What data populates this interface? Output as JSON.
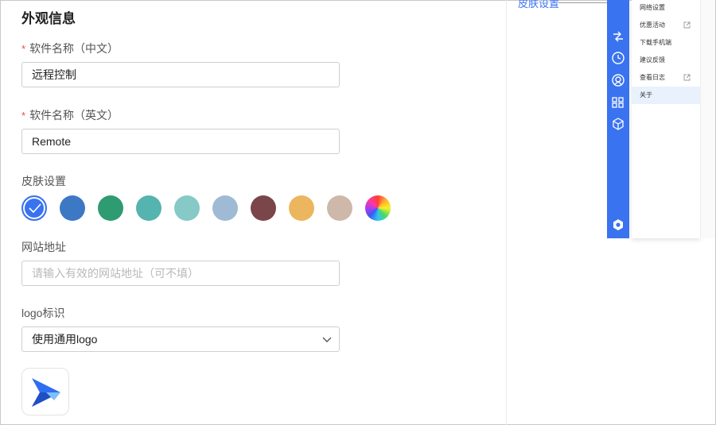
{
  "form": {
    "section_title": "外观信息",
    "required_mark": "*",
    "name_cn": {
      "label": "软件名称（中文）",
      "value": "远程控制"
    },
    "name_en": {
      "label": "软件名称（英文）",
      "value": "Remote"
    },
    "skin": {
      "label": "皮肤设置",
      "swatches": [
        "#3a73f0",
        "#3d78c4",
        "#2e9b72",
        "#55b3b0",
        "#86c9c7",
        "#9fbad4",
        "#7a4649",
        "#ecb65e",
        "#cdb8aa",
        "rainbow"
      ],
      "selected_index": 0
    },
    "website": {
      "label": "网站地址",
      "value": "",
      "placeholder": "请输入有效的网站地址（可不填）"
    },
    "logo": {
      "label": "logo标识",
      "selected": "使用通用logo"
    }
  },
  "preview": {
    "link_label": "皮肤设置",
    "sidebar_color": "#3a73f0",
    "sidebar_icons": [
      "transfer-icon",
      "clock-icon",
      "webcam-icon",
      "apps-grid-icon",
      "cube-icon",
      "app-logo-icon"
    ],
    "menu": [
      {
        "label": "网络设置",
        "external": false
      },
      {
        "label": "优惠活动",
        "external": true
      },
      {
        "label": "下载手机端",
        "external": false
      },
      {
        "label": "建议反馈",
        "external": false
      },
      {
        "label": "查看日志",
        "external": true
      },
      {
        "label": "关于",
        "external": false,
        "active": true
      }
    ]
  }
}
